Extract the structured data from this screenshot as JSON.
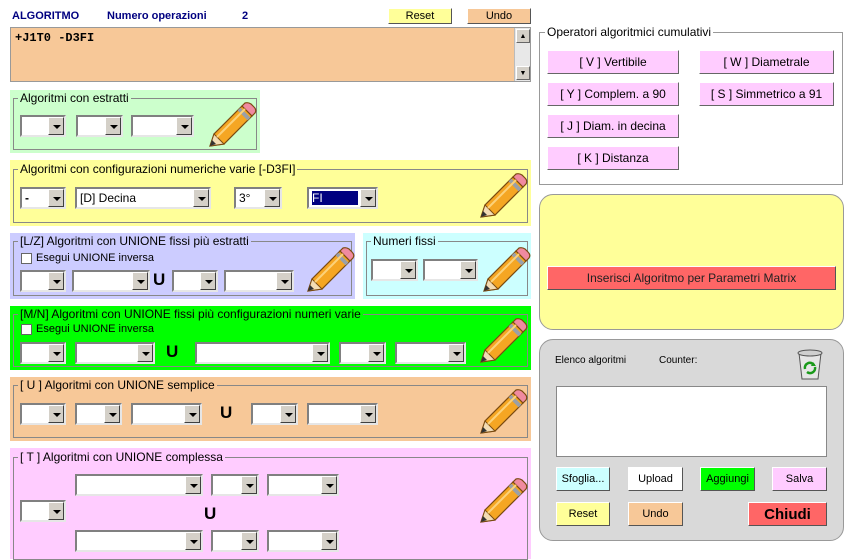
{
  "header": {
    "title": "ALGORITMO",
    "operations_label": "Numero operazioni",
    "operations_count": "2",
    "reset_label": "Reset",
    "undo_label": "Undo"
  },
  "algorithm_text": "+J1T0 -D3FI",
  "estratti": {
    "legend": "Algoritmi con estratti",
    "values": [
      "",
      "",
      ""
    ]
  },
  "config": {
    "legend": "Algoritmi con configurazioni numeriche varie  [-D3FI]",
    "sign": "-",
    "type": "[D] Decina",
    "position": "3°",
    "option": "FI"
  },
  "lz": {
    "legend": "[L/Z] Algoritmi con UNIONE fissi più estratti",
    "checkbox_label": "Esegui UNIONE inversa",
    "union": "U"
  },
  "numeri_fissi": {
    "legend": "Numeri fissi"
  },
  "mn": {
    "legend": "[M/N] Algoritmi con UNIONE fissi più configurazioni numeri varie",
    "checkbox_label": "Esegui UNIONE inversa",
    "union": "U"
  },
  "u_semplice": {
    "legend": "[ U ] Algoritmi con UNIONE semplice",
    "union": "U"
  },
  "t_complessa": {
    "legend": "[ T ] Algoritmi con UNIONE complessa",
    "union": "U"
  },
  "operators": {
    "legend": "Operatori algoritmici cumulativi",
    "v": "[ V ] Vertibile",
    "w": "[ W ] Diametrale",
    "y": "[ Y ] Complem. a 90",
    "s": "[ S ] Simmetrico  a 91",
    "j": "[ J ] Diam. in decina",
    "k": "[ K ] Distanza"
  },
  "matrix": {
    "button_label": "Inserisci Algoritmo per Parametri Matrix"
  },
  "list": {
    "elenco_label": "Elenco algoritmi",
    "counter_label": "Counter:",
    "sfoglia": "Sfoglia...",
    "upload": "Upload",
    "aggiungi": "Aggiungi",
    "salva": "Salva",
    "reset": "Reset",
    "undo": "Undo",
    "chiudi": "Chiudi"
  },
  "colors": {
    "orange": "#f7c898",
    "green_light": "#ccffcc",
    "yellow": "#ffff99",
    "lavender": "#ccccff",
    "cyan": "#ccffff",
    "green": "#00ff00",
    "pink": "#ffccff",
    "matrix_red": "#ff6666"
  }
}
